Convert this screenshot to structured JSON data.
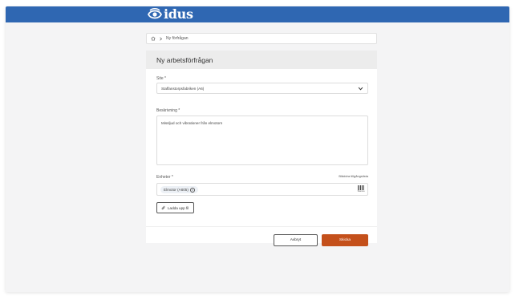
{
  "header": {
    "brand": "idus"
  },
  "breadcrumb": {
    "current": "Ny förfrågan"
  },
  "form": {
    "title": "Ny arbetsförfrågan",
    "site": {
      "label": "Site *",
      "value": "Staffanstorpsfabriken (A6)"
    },
    "description": {
      "label": "Beskrivning *",
      "value": "Missljud och vibrationer från elmotorn"
    },
    "units": {
      "label": "Enheter *",
      "link": "Bläddra tillgångslista",
      "chips": [
        "Elmotor (A605)"
      ],
      "scan_label": "Skanna"
    },
    "upload_label": "Ladda upp fil",
    "cancel_label": "Avbryt",
    "submit_label": "Skicka"
  },
  "colors": {
    "topbar": "#2f67b2",
    "submit": "#c4501b"
  },
  "icons": [
    "eye-logo-icon",
    "home-icon",
    "chevron-right-icon",
    "chevron-down-icon",
    "close-circle-icon",
    "barcode-icon",
    "paperclip-icon"
  ]
}
